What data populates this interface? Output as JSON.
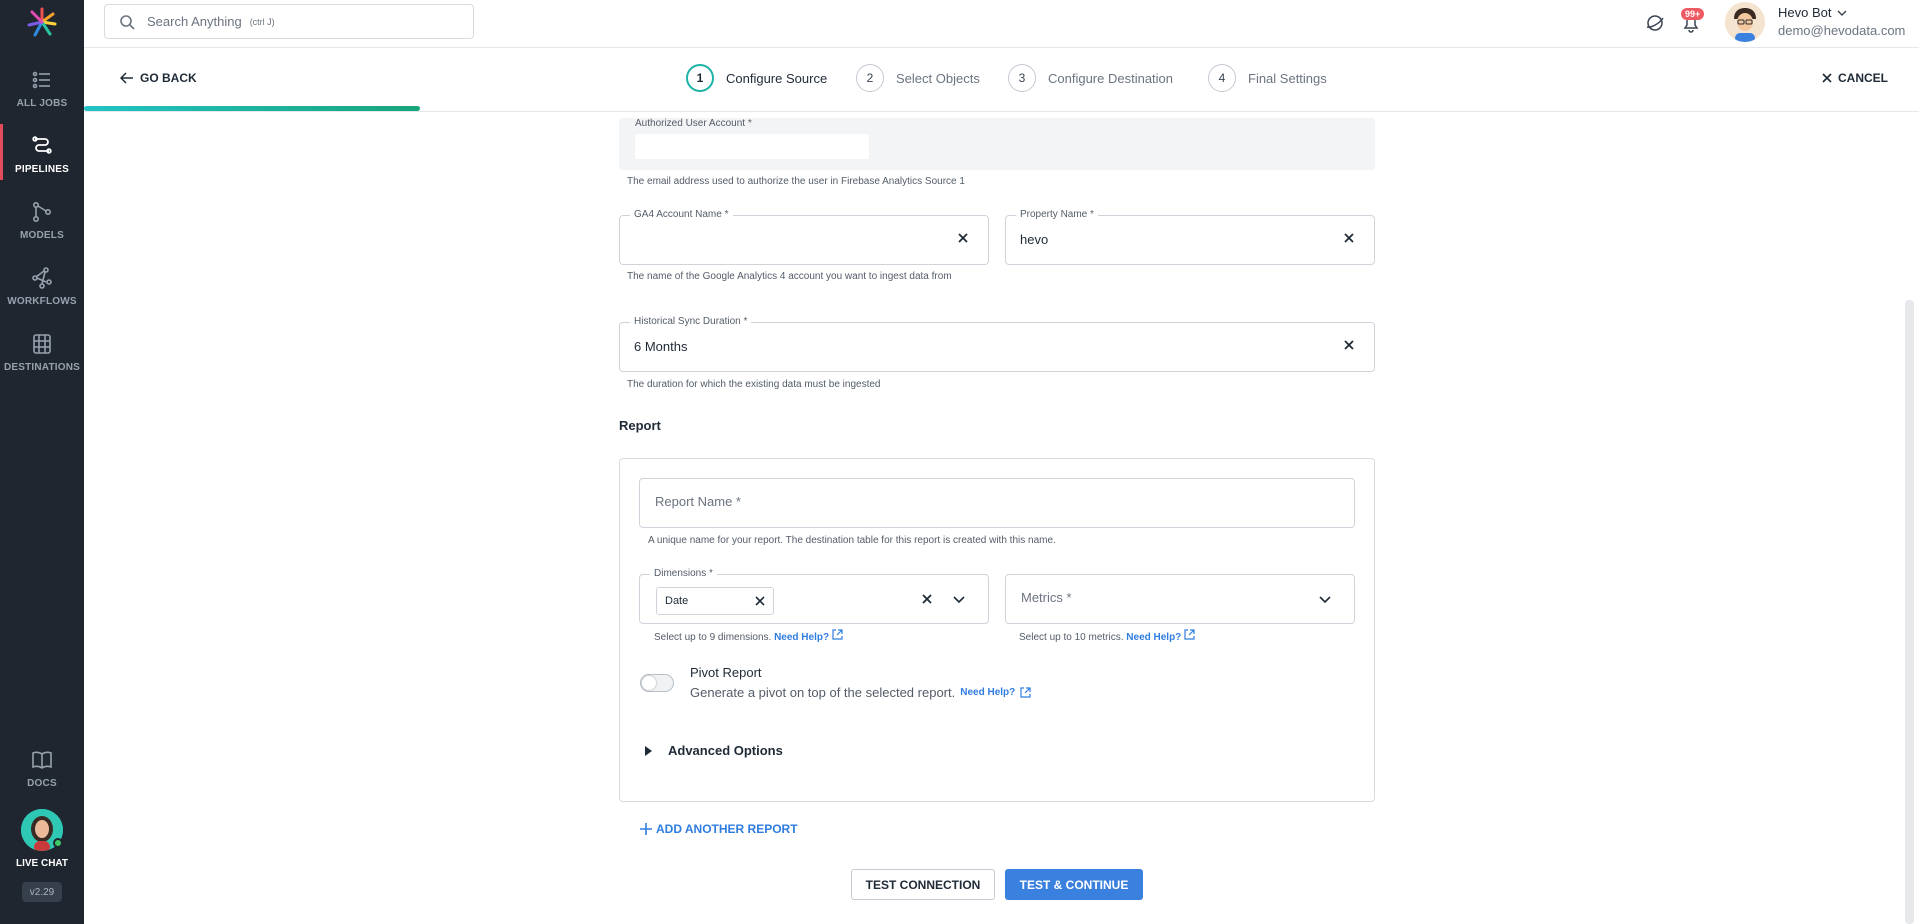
{
  "sidebar": {
    "items": [
      {
        "label": "ALL JOBS",
        "icon": "list-icon"
      },
      {
        "label": "PIPELINES",
        "icon": "pipeline-icon",
        "active": true
      },
      {
        "label": "MODELS",
        "icon": "models-icon"
      },
      {
        "label": "WORKFLOWS",
        "icon": "workflows-icon"
      },
      {
        "label": "DESTINATIONS",
        "icon": "destinations-icon"
      }
    ],
    "docs_label": "DOCS",
    "live_chat_label": "LIVE CHAT",
    "version": "v2.29"
  },
  "topbar": {
    "search_placeholder": "Search Anything",
    "search_shortcut": "(ctrl J)",
    "notification_count": "99+",
    "user_name": "Hevo Bot",
    "user_email": "demo@hevodata.com"
  },
  "wizard": {
    "go_back": "GO BACK",
    "cancel": "CANCEL",
    "steps": [
      {
        "num": "1",
        "label": "Configure Source"
      },
      {
        "num": "2",
        "label": "Select Objects"
      },
      {
        "num": "3",
        "label": "Configure Destination"
      },
      {
        "num": "4",
        "label": "Final Settings"
      }
    ],
    "progress_fraction": 0.18
  },
  "form": {
    "auth_label": "Authorized User Account *",
    "auth_hint": "The email address used to authorize the user in Firebase Analytics Source 1",
    "ga4_label": "GA4 Account Name *",
    "ga4_value": "",
    "ga4_hint": "The name of the Google Analytics 4 account you want to ingest data from",
    "property_label": "Property Name *",
    "property_value": "hevo",
    "sync_label": "Historical Sync Duration *",
    "sync_value": "6 Months",
    "sync_hint": "The duration for which the existing data must be ingested"
  },
  "report": {
    "section_title": "Report",
    "name_placeholder": "Report Name *",
    "name_hint": "A unique name for your report. The destination table for this report is created with this name.",
    "dimensions_label": "Dimensions *",
    "dimension_chip": "Date",
    "dimensions_hint": "Select up to 9 dimensions.",
    "metrics_placeholder": "Metrics *",
    "metrics_hint": "Select up to 10 metrics.",
    "need_help": "Need Help?",
    "pivot_title": "Pivot Report",
    "pivot_desc": "Generate a pivot on top of the selected report.",
    "advanced_options": "Advanced Options",
    "add_another": "ADD ANOTHER REPORT"
  },
  "buttons": {
    "test_connection": "TEST CONNECTION",
    "test_continue": "TEST & CONTINUE"
  },
  "colors": {
    "sidebar_bg": "#1f2630",
    "accent_blue": "#3a80de",
    "active_marker": "#e24b5a",
    "progress": "#1db3a7"
  }
}
